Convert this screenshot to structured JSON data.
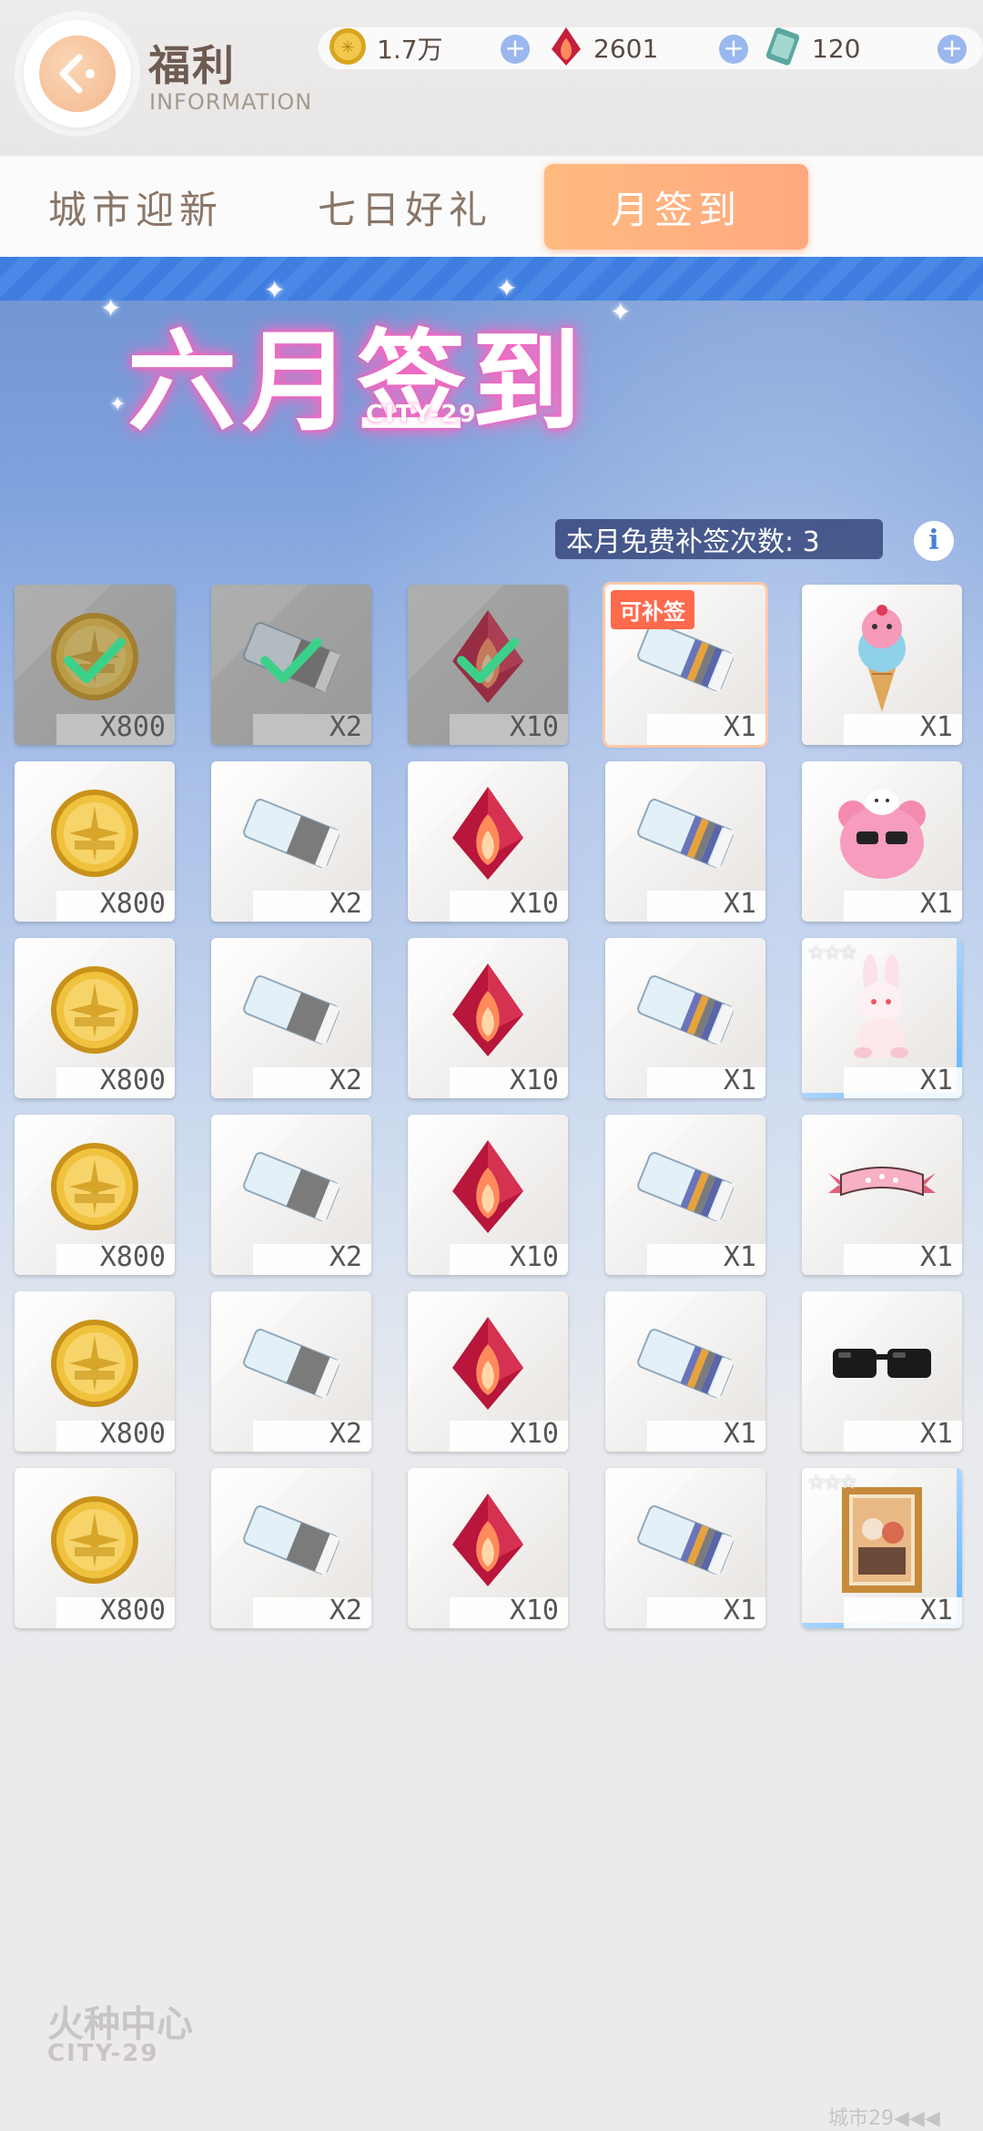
{
  "header": {
    "title": "福利",
    "subtitle": "INFORMATION"
  },
  "currencies": [
    {
      "icon": "gold-coin-icon",
      "value": "1.7万"
    },
    {
      "icon": "red-crystal-icon",
      "value": "2601"
    },
    {
      "icon": "ticket-card-icon",
      "value": "120"
    }
  ],
  "tabs": [
    {
      "label": "城市迎新",
      "active": false
    },
    {
      "label": "七日好礼",
      "active": false
    },
    {
      "label": "月签到",
      "active": true
    }
  ],
  "banner": {
    "title": "六月签到",
    "subtitle": "CITY-29"
  },
  "free_makeup_text": "本月免费补签次数: 3",
  "makeup_tag_label": "可补签",
  "rewards": [
    {
      "item": "gold-coin",
      "qty": "X800",
      "state": "claimed"
    },
    {
      "item": "white-box-gray",
      "qty": "X2",
      "state": "claimed"
    },
    {
      "item": "red-crystal",
      "qty": "X10",
      "state": "claimed"
    },
    {
      "item": "white-box-striped",
      "qty": "X1",
      "state": "makeup"
    },
    {
      "item": "ice-cream",
      "qty": "X1",
      "state": "normal"
    },
    {
      "item": "gold-coin",
      "qty": "X800",
      "state": "normal"
    },
    {
      "item": "white-box-gray",
      "qty": "X2",
      "state": "normal"
    },
    {
      "item": "red-crystal",
      "qty": "X10",
      "state": "normal"
    },
    {
      "item": "white-box-striped",
      "qty": "X1",
      "state": "normal"
    },
    {
      "item": "pink-bear",
      "qty": "X1",
      "state": "normal"
    },
    {
      "item": "gold-coin",
      "qty": "X800",
      "state": "normal"
    },
    {
      "item": "white-box-gray",
      "qty": "X2",
      "state": "normal"
    },
    {
      "item": "red-crystal",
      "qty": "X10",
      "state": "normal"
    },
    {
      "item": "white-box-striped",
      "qty": "X1",
      "state": "normal"
    },
    {
      "item": "bunny-figure",
      "qty": "X1",
      "state": "rare"
    },
    {
      "item": "gold-coin",
      "qty": "X800",
      "state": "normal"
    },
    {
      "item": "white-box-gray",
      "qty": "X2",
      "state": "normal"
    },
    {
      "item": "red-crystal",
      "qty": "X10",
      "state": "normal"
    },
    {
      "item": "white-box-striped",
      "qty": "X1",
      "state": "normal"
    },
    {
      "item": "ribbon-banner",
      "qty": "X1",
      "state": "normal"
    },
    {
      "item": "gold-coin",
      "qty": "X800",
      "state": "normal"
    },
    {
      "item": "white-box-gray",
      "qty": "X2",
      "state": "normal"
    },
    {
      "item": "red-crystal",
      "qty": "X10",
      "state": "normal"
    },
    {
      "item": "white-box-striped",
      "qty": "X1",
      "state": "normal"
    },
    {
      "item": "sunglasses",
      "qty": "X1",
      "state": "normal"
    },
    {
      "item": "gold-coin",
      "qty": "X800",
      "state": "normal"
    },
    {
      "item": "white-box-gray",
      "qty": "X2",
      "state": "normal"
    },
    {
      "item": "red-crystal",
      "qty": "X10",
      "state": "normal"
    },
    {
      "item": "white-box-striped",
      "qty": "X1",
      "state": "normal"
    },
    {
      "item": "photo-frame",
      "qty": "X1",
      "state": "rare"
    }
  ],
  "footer": {
    "logo": "火种中心",
    "logo_sub": "CITY-29",
    "right_text": "城市29◀◀◀"
  },
  "colors": {
    "accent": "#ffb080",
    "tab_inactive_text": "#8a7668",
    "makeup_tag": "#ff6a4d",
    "check": "#3cd18a"
  }
}
